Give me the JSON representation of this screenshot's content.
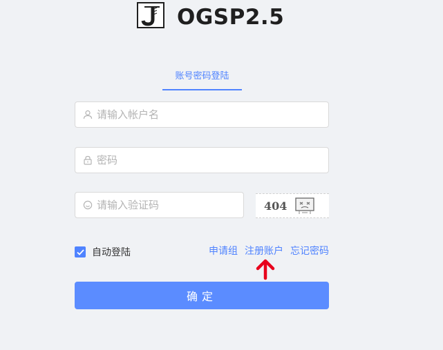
{
  "header": {
    "logo_letter": "J",
    "title": "OGSP2.5"
  },
  "tabs": [
    {
      "label": "账号密码登陆",
      "active": true
    }
  ],
  "form": {
    "username": {
      "placeholder": "请输入帐户名",
      "value": ""
    },
    "password": {
      "placeholder": "密码",
      "value": ""
    },
    "captcha": {
      "placeholder": "请输入验证码",
      "value": "",
      "image_text": "404"
    }
  },
  "options": {
    "remember_label": "自动登陆",
    "remember_checked": true,
    "links": {
      "apply": "申请组",
      "register": "注册账户",
      "forgot": "忘记密码"
    }
  },
  "submit_label": "确定",
  "colors": {
    "accent": "#4f83ff",
    "button": "#5b8cff",
    "annotation_arrow": "#e8001c",
    "background": "#f0f2f5"
  },
  "icons": {
    "username": "user-icon",
    "password": "lock-icon",
    "captcha": "smiley-icon",
    "annotation": "red-arrow-up-icon"
  }
}
